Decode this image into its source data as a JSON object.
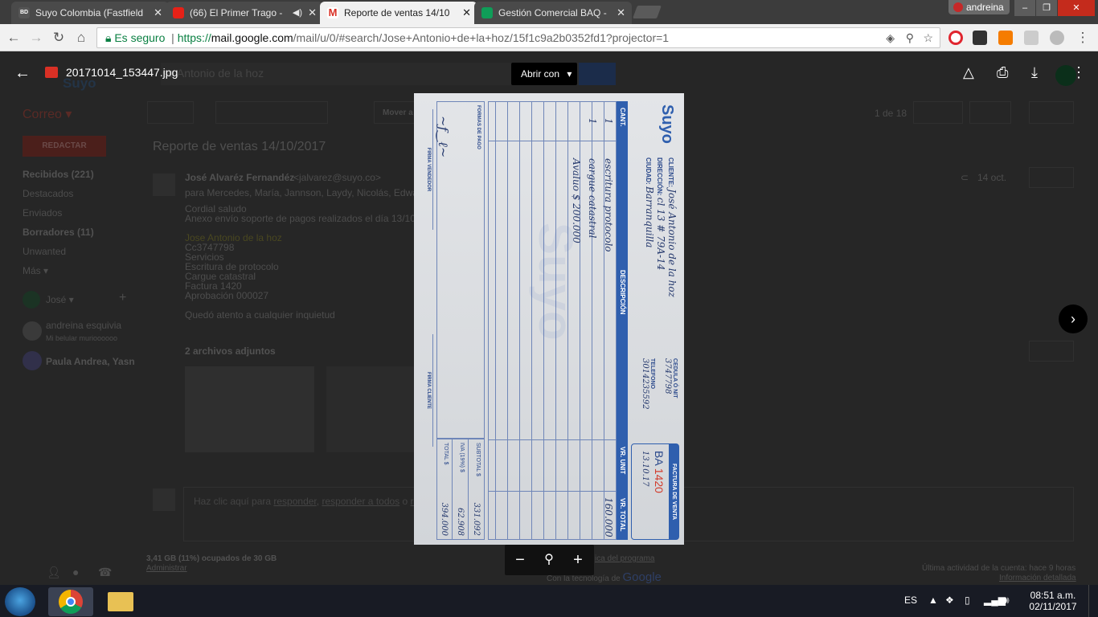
{
  "browser": {
    "tabs": [
      {
        "title": "Suyo Colombia (Fastfield",
        "favicon": "bd-icon",
        "active": false
      },
      {
        "title": "(66) El Primer Trago - ",
        "favicon": "youtube-icon",
        "active": false
      },
      {
        "title": "Reporte de ventas 14/10",
        "favicon": "gmail-icon",
        "active": true
      },
      {
        "title": "Gestión Comercial BAQ -",
        "favicon": "sheets-icon",
        "active": false
      }
    ],
    "profile_name": "andreina",
    "secure_label": "Es seguro",
    "url_scheme": "https://",
    "url_host": "mail.google.com",
    "url_path": "/mail/u/0/#search/Jose+Antonio+de+la+hoz/15f1c9a2b0352fd1?projector=1"
  },
  "viewer": {
    "file_name": "20171014_153447.jpg",
    "open_with_label": "Abrir con"
  },
  "gmail": {
    "brand": "Suyo",
    "search_text": "se Antonio de la hoz",
    "mail_label": "Correo",
    "compose_label": "REDACTAR",
    "folders": [
      {
        "label": "Recibidos (221)",
        "bold": true
      },
      {
        "label": "Destacados",
        "bold": false
      },
      {
        "label": "Enviados",
        "bold": false
      },
      {
        "label": "Borradores (11)",
        "bold": true
      },
      {
        "label": "Unwanted",
        "bold": false
      },
      {
        "label": "Más",
        "bold": false
      }
    ],
    "hangouts_user": "José",
    "contacts": [
      {
        "name": "andreina esquivia",
        "status": "Mi belular murioooooo"
      },
      {
        "name": "Paula Andrea, Yasn",
        "status": ""
      }
    ],
    "move_to": "Mover a",
    "pager": "1 de 18",
    "subject": "Reporte de ventas 14/10/2017",
    "sender": "José Alvaréz Fernandéz",
    "sender_email": "<jalvarez@suyo.co>",
    "recipients": "para Mercedes, María, Jannson, Laydy, Nicolás, Edwar",
    "date": "14 oct.",
    "body_lines": [
      "Cordial saludo",
      "Anexo envío soporte de pagos realizados el día 13/10/1",
      "",
      "Jose Antonio de la hoz",
      "Cc3747798",
      "Servicios",
      "Escritura de protocolo",
      "Cargue catastral",
      "Factura 1420",
      "Aprobación 000027",
      "",
      "Quedó atento a cualquier inquietud"
    ],
    "attachments_label": "2 archivos adjuntos",
    "reply_prompt": "Haz clic aquí para",
    "reply_link": "responder",
    "reply_all_link": "responder a todos",
    "reply_or": "o",
    "reply_fwd": "ree",
    "storage": "3,41 GB (11%) ocupados de 30 GB",
    "manage": "Administrar",
    "program_policies": "ica del programa",
    "powered_by": "Con la tecnología de",
    "google": "Google",
    "last_activity": "Última actividad de la cuenta: hace 9 horas",
    "details": "Información detallada"
  },
  "invoice": {
    "company": "Suyo",
    "title": "FACTURA DE VENTA",
    "series": "BA",
    "number": "1420",
    "date_written": "13.10.17",
    "client_label": "CLIENTE:",
    "client": "José Antonio de la hoz",
    "address_label": "DIRECCIÓN:",
    "address": "cl 13 # 79A-14",
    "city_label": "CIUDAD:",
    "city": "Barranquilla",
    "id_label": "CEDULA Ó NIT",
    "id_value": "3747798",
    "phone_label": "TELEFONO",
    "phone_value": "3014235592",
    "col_qty": "CANT.",
    "col_desc": "DESCRIPCIÓN",
    "col_unit": "VR. UNIT",
    "col_total": "VR. TOTAL",
    "lines": [
      {
        "qty": "1",
        "desc": "escritura protocolo",
        "total": "160.000"
      },
      {
        "qty": "1",
        "desc": "cargue catastral",
        "total": ""
      },
      {
        "qty": "",
        "desc": "Avaluo $ 200.000",
        "total": ""
      }
    ],
    "subtotal_label": "SUBTOTAL $",
    "subtotal": "331.092",
    "iva_label": "IVA (19%) $",
    "iva": "62.908",
    "total_label": "TOTAL $",
    "total": "394.000",
    "payment_label": "FORMAS DE PAGO",
    "seller_sign_label": "FIRMA VENDEDOR",
    "client_sign_label": "FIRMA CLIENTE",
    "watermark": "Suyo"
  },
  "taskbar": {
    "language": "ES",
    "time": "08:51 a.m.",
    "date": "02/11/2017"
  }
}
